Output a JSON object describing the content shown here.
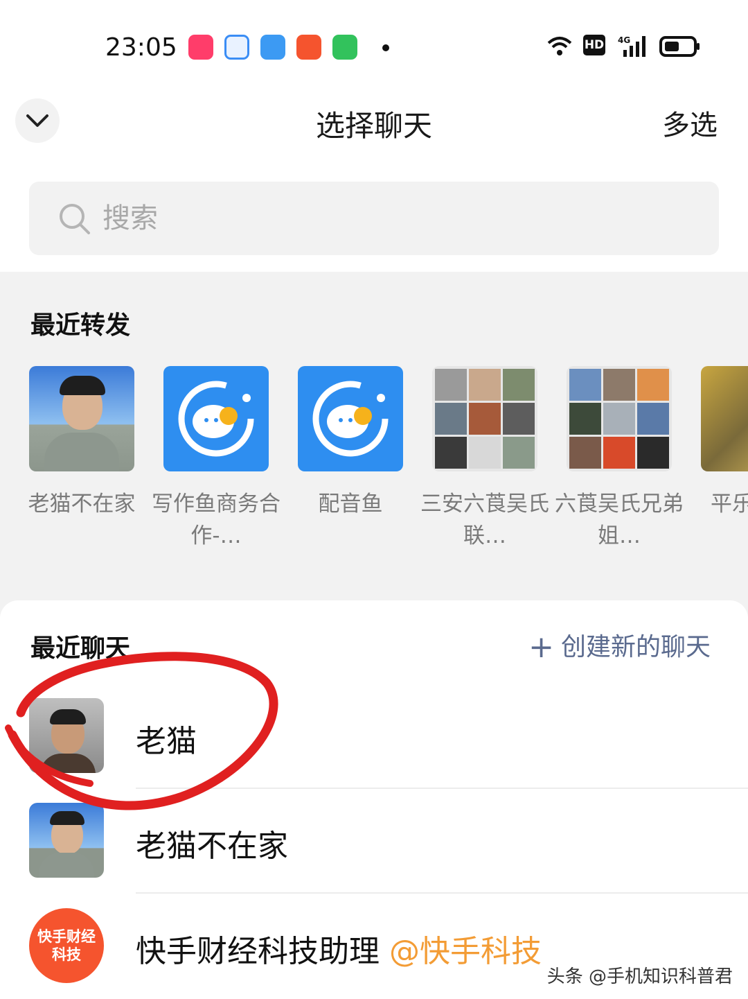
{
  "status_bar": {
    "time": "23:05",
    "app_icons": [
      "kuaishou-icon",
      "browser-icon",
      "weather-icon",
      "game-icon",
      "store-icon"
    ],
    "indicators": [
      "wifi-icon",
      "hd-icon",
      "signal-4g-icon",
      "battery-icon"
    ],
    "hd_label": "HD",
    "network_label": "4G"
  },
  "header": {
    "title": "选择聊天",
    "multi_select": "多选"
  },
  "search": {
    "placeholder": "搜索"
  },
  "recent_forward": {
    "title": "最近转发",
    "items": [
      {
        "label": "老猫不在家"
      },
      {
        "label": "写作鱼商务合作-…"
      },
      {
        "label": "配音鱼"
      },
      {
        "label": "三安六莨吴氏联…"
      },
      {
        "label": "六莨吴氏兄弟姐…"
      },
      {
        "label": "平乐快递"
      }
    ]
  },
  "recent_chats": {
    "title": "最近聊天",
    "create_label": "创建新的聊天",
    "items": [
      {
        "name": "老猫",
        "tag": ""
      },
      {
        "name": "老猫不在家",
        "tag": ""
      },
      {
        "name": "快手财经科技助理",
        "tag": "@快手科技",
        "avatar_text": "快手财经科技"
      }
    ]
  },
  "watermark": "头条 @手机知识科普君",
  "colors": {
    "accent_link": "#5a6a8e",
    "tag_orange": "#f39c35",
    "annotation_red": "#e02020",
    "app_blue": "#2e8ef0"
  }
}
